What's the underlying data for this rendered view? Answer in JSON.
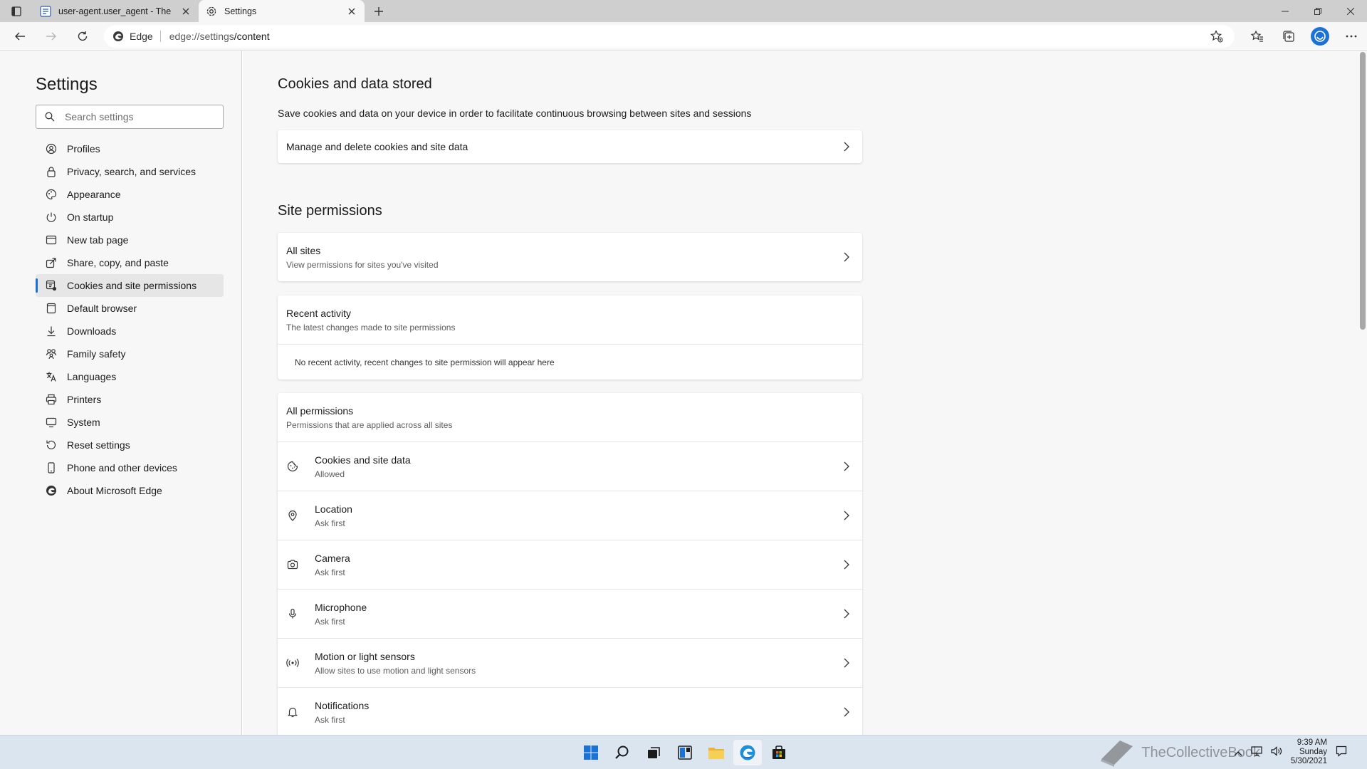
{
  "browser": {
    "tabs": [
      {
        "title": "user-agent.user_agent - The Coll",
        "active": false
      },
      {
        "title": "Settings",
        "active": true
      }
    ],
    "address": {
      "site_label": "Edge",
      "url_host": "edge://settings",
      "url_path": "/content"
    }
  },
  "sidebar": {
    "title": "Settings",
    "search_placeholder": "Search settings",
    "items": [
      {
        "label": "Profiles",
        "icon": "profile-icon"
      },
      {
        "label": "Privacy, search, and services",
        "icon": "lock-icon"
      },
      {
        "label": "Appearance",
        "icon": "palette-icon"
      },
      {
        "label": "On startup",
        "icon": "power-icon"
      },
      {
        "label": "New tab page",
        "icon": "newtab-icon"
      },
      {
        "label": "Share, copy, and paste",
        "icon": "share-icon"
      },
      {
        "label": "Cookies and site permissions",
        "icon": "cookie-permissions-icon",
        "active": true
      },
      {
        "label": "Default browser",
        "icon": "browser-icon"
      },
      {
        "label": "Downloads",
        "icon": "download-icon"
      },
      {
        "label": "Family safety",
        "icon": "family-icon"
      },
      {
        "label": "Languages",
        "icon": "language-icon"
      },
      {
        "label": "Printers",
        "icon": "printer-icon"
      },
      {
        "label": "System",
        "icon": "system-icon"
      },
      {
        "label": "Reset settings",
        "icon": "reset-icon"
      },
      {
        "label": "Phone and other devices",
        "icon": "phone-icon"
      },
      {
        "label": "About Microsoft Edge",
        "icon": "edge-logo-icon"
      }
    ]
  },
  "main": {
    "cookies_section": {
      "title": "Cookies and data stored",
      "description": "Save cookies and data on your device in order to facilitate continuous browsing between sites and sessions",
      "manage_label": "Manage and delete cookies and site data"
    },
    "site_permissions": {
      "title": "Site permissions",
      "all_sites": {
        "title": "All sites",
        "subtitle": "View permissions for sites you've visited"
      },
      "recent_activity": {
        "title": "Recent activity",
        "subtitle": "The latest changes made to site permissions",
        "empty_text": "No recent activity, recent changes to site permission will appear here"
      },
      "all_permissions": {
        "title": "All permissions",
        "subtitle": "Permissions that are applied across all sites",
        "items": [
          {
            "title": "Cookies and site data",
            "status": "Allowed",
            "icon": "cookie-icon"
          },
          {
            "title": "Location",
            "status": "Ask first",
            "icon": "location-icon"
          },
          {
            "title": "Camera",
            "status": "Ask first",
            "icon": "camera-icon"
          },
          {
            "title": "Microphone",
            "status": "Ask first",
            "icon": "microphone-icon"
          },
          {
            "title": "Motion or light sensors",
            "status": "Allow sites to use motion and light sensors",
            "icon": "sensor-icon"
          },
          {
            "title": "Notifications",
            "status": "Ask first",
            "icon": "bell-icon"
          }
        ]
      }
    }
  },
  "taskbar": {
    "time": "9:39 AM",
    "day": "Sunday",
    "date": "5/30/2021",
    "watermark": "TheCollectiveBook"
  },
  "colors": {
    "accent": "#1c72d4",
    "page_bg": "#f7f7f7",
    "card_bg": "#ffffff"
  }
}
